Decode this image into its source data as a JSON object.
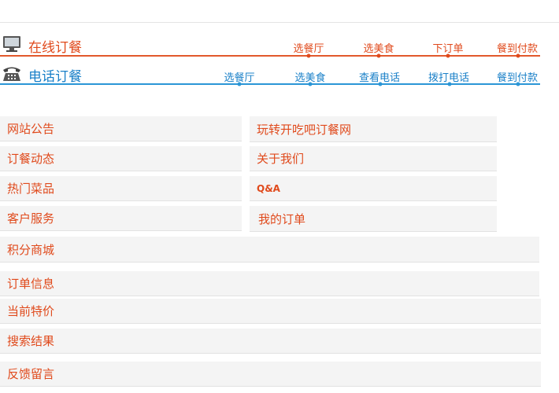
{
  "online_order": {
    "title": "在线订餐",
    "steps": [
      "选餐厅",
      "选美食",
      "下订单",
      "餐到付款"
    ],
    "color": "#e04a1c"
  },
  "phone_order": {
    "title": "电话订餐",
    "steps": [
      "选餐厅",
      "选美食",
      "查看电话",
      "拨打电话",
      "餐到付款"
    ],
    "color": "#1a80c8"
  },
  "menu": {
    "left": [
      "网站公告",
      "订餐动态",
      "热门菜品",
      "客户服务"
    ],
    "right": [
      "玩转开吃吧订餐网",
      "关于我们",
      "Q&A",
      "我的订单"
    ],
    "full": [
      "积分商城",
      "订单信息",
      "当前特价",
      "搜索结果",
      "反馈留言"
    ]
  }
}
